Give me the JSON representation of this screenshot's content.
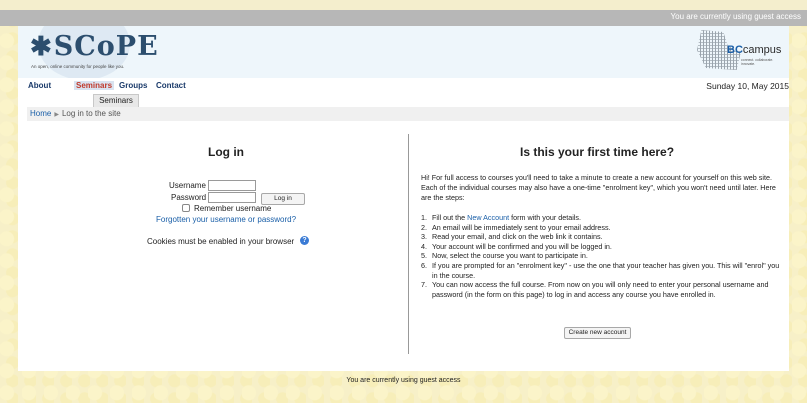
{
  "topbar": {
    "guest_notice": "You are currently using guest access"
  },
  "header": {
    "logo_text": "SCoPE",
    "logo_tagline": "An open, online community for people like you.",
    "partner_logo_name": "BC",
    "partner_logo_name_suffix": "campus",
    "partner_logo_tagline": "connect. collaborate. innovate."
  },
  "nav": {
    "items": [
      {
        "label": "About"
      },
      {
        "label": "Seminars"
      },
      {
        "label": "Groups"
      },
      {
        "label": "Contact"
      }
    ],
    "dropdown_item": "Seminars",
    "date": "Sunday 10, May 2015"
  },
  "breadcrumb": {
    "home": "Home",
    "current": "Log in to the site"
  },
  "login": {
    "title": "Log in",
    "username_label": "Username",
    "password_label": "Password",
    "button": "Log in",
    "remember_label": "Remember username",
    "forgot_link": "Forgotten your username or password?",
    "cookies_notice": "Cookies must be enabled in your browser"
  },
  "first_time": {
    "title": "Is this your first time here?",
    "intro": "Hi! For full access to courses you'll need to take a minute to create a new account for yourself on this web site. Each of the individual courses may also have a one-time \"enrolment key\", which you won't need until later. Here are the steps:",
    "step1_pre": "Fill out the ",
    "step1_link": "New Account",
    "step1_post": " form with your details.",
    "steps": [
      "An email will be immediately sent to your email address.",
      "Read your email, and click on the web link it contains.",
      "Your account will be confirmed and you will be logged in.",
      "Now, select the course you want to participate in.",
      "If you are prompted for an \"enrolment key\" - use the one that your teacher has given you. This will \"enrol\" you in the course.",
      "You can now access the full course. From now on you will only need to enter your personal username and password (in the form on this page) to log in and access any course you have enrolled in."
    ],
    "create_button": "Create new account"
  },
  "footer": {
    "guest_notice": "You are currently using guest access"
  }
}
